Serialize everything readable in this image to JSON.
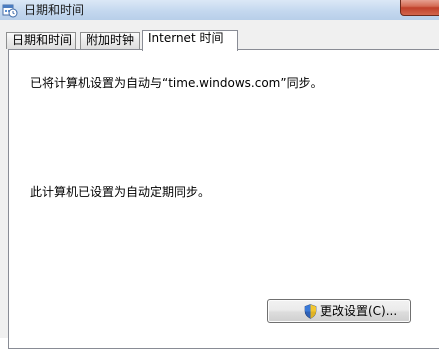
{
  "window": {
    "title": "日期和时间",
    "title_icon": "date-time-icon",
    "close_icon": "close-icon"
  },
  "tabs": [
    {
      "label": "日期和时间",
      "active": false
    },
    {
      "label": "附加时钟",
      "active": false
    },
    {
      "label": "Internet 时间",
      "active": true
    }
  ],
  "content": {
    "sync_server_text": "已将计算机设置为自动与“time.windows.com”同步。",
    "schedule_text": "此计算机已设置为自动定期同步。",
    "change_button_label": "更改设置(C)...",
    "change_button_icon": "uac-shield-icon"
  },
  "colors": {
    "titlebar": "#c4d8ef",
    "close_button": "#c0402a",
    "panel_border": "#898c95"
  }
}
